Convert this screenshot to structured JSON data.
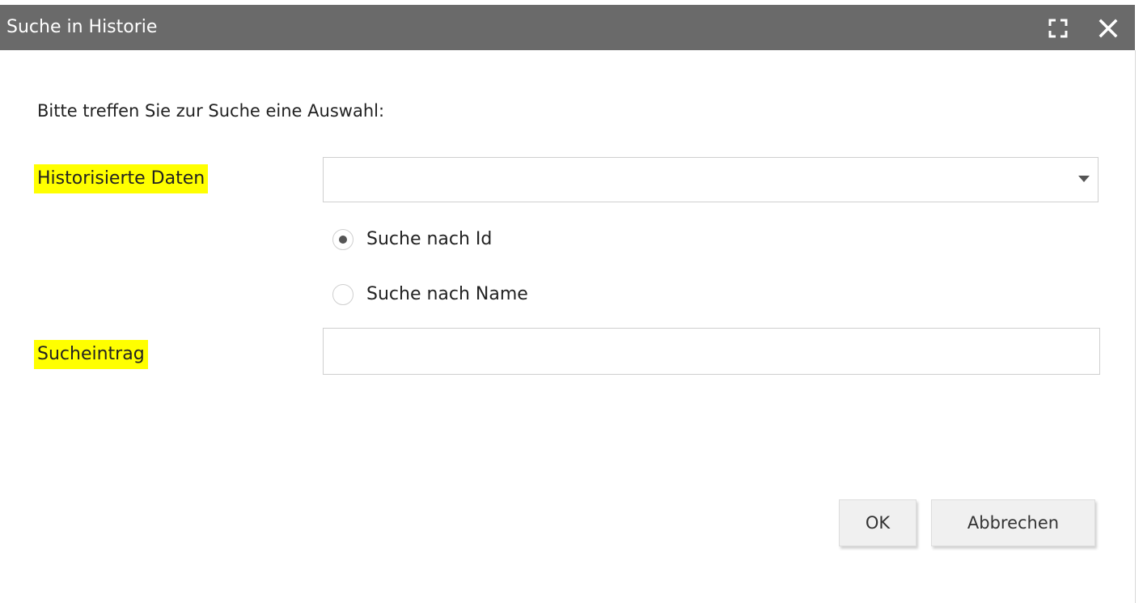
{
  "dialog": {
    "title": "Suche in Historie",
    "maximize_icon": "maximize-icon",
    "close_icon": "close-icon"
  },
  "form": {
    "instruction": "Bitte treffen Sie zur Suche eine Auswahl:",
    "historized_data_label": "Historisierte Daten",
    "historized_data_value": "",
    "radio_options": [
      {
        "label": "Suche nach Id",
        "checked": true
      },
      {
        "label": "Suche nach Name",
        "checked": false
      }
    ],
    "search_entry_label": "Sucheintrag",
    "search_entry_value": "",
    "highlight_color": "#ffff00"
  },
  "buttons": {
    "ok": "OK",
    "cancel": "Abbrechen"
  }
}
